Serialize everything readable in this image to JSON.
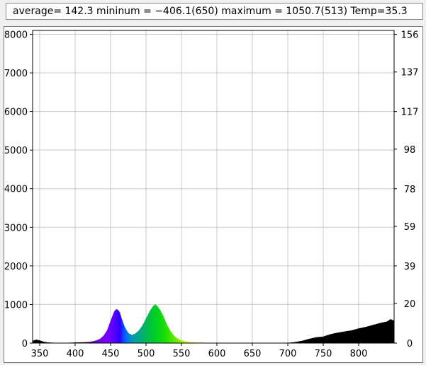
{
  "status": {
    "text": "average= 142.3 mininum = −406.1(650) maximum = 1050.7(513) Temp=35.3"
  },
  "chart_data": {
    "type": "area",
    "title": "",
    "xlabel": "",
    "ylabel": "",
    "xlim": [
      340,
      850
    ],
    "ylim": [
      0,
      8100
    ],
    "y2lim": [
      0,
      158
    ],
    "grid": true,
    "x_ticks": [
      350,
      400,
      450,
      500,
      550,
      600,
      650,
      700,
      750,
      800
    ],
    "y_ticks": [
      0,
      1000,
      2000,
      3000,
      4000,
      5000,
      6000,
      7000,
      8000
    ],
    "y2_ticks": [
      0,
      20,
      39,
      59,
      78,
      98,
      117,
      137,
      156
    ],
    "fill": "wavelength-spectrum colors (violet to green) under peaks; black above 700",
    "series": [
      {
        "x": [
          340,
          345,
          350,
          355,
          360,
          370,
          380,
          390,
          400,
          410,
          420,
          425,
          430,
          435,
          440,
          445,
          450,
          455,
          458,
          460,
          463,
          466,
          470,
          475,
          480,
          485,
          490,
          495,
          500,
          505,
          510,
          513,
          516,
          520,
          525,
          530,
          535,
          540,
          545,
          550,
          555,
          560,
          570,
          580,
          590,
          600,
          620,
          640,
          660,
          680,
          700,
          710,
          720,
          730,
          740,
          750,
          760,
          770,
          780,
          790,
          800,
          810,
          820,
          830,
          840,
          845,
          850
        ],
        "y": [
          60,
          90,
          70,
          40,
          20,
          10,
          5,
          10,
          15,
          20,
          30,
          45,
          70,
          110,
          190,
          330,
          580,
          820,
          880,
          870,
          800,
          620,
          420,
          260,
          210,
          250,
          330,
          460,
          640,
          820,
          960,
          1000,
          960,
          860,
          680,
          460,
          300,
          180,
          110,
          70,
          45,
          30,
          15,
          10,
          8,
          5,
          5,
          5,
          5,
          5,
          10,
          25,
          60,
          110,
          150,
          170,
          230,
          270,
          300,
          330,
          380,
          420,
          470,
          520,
          560,
          620,
          580
        ]
      }
    ]
  }
}
